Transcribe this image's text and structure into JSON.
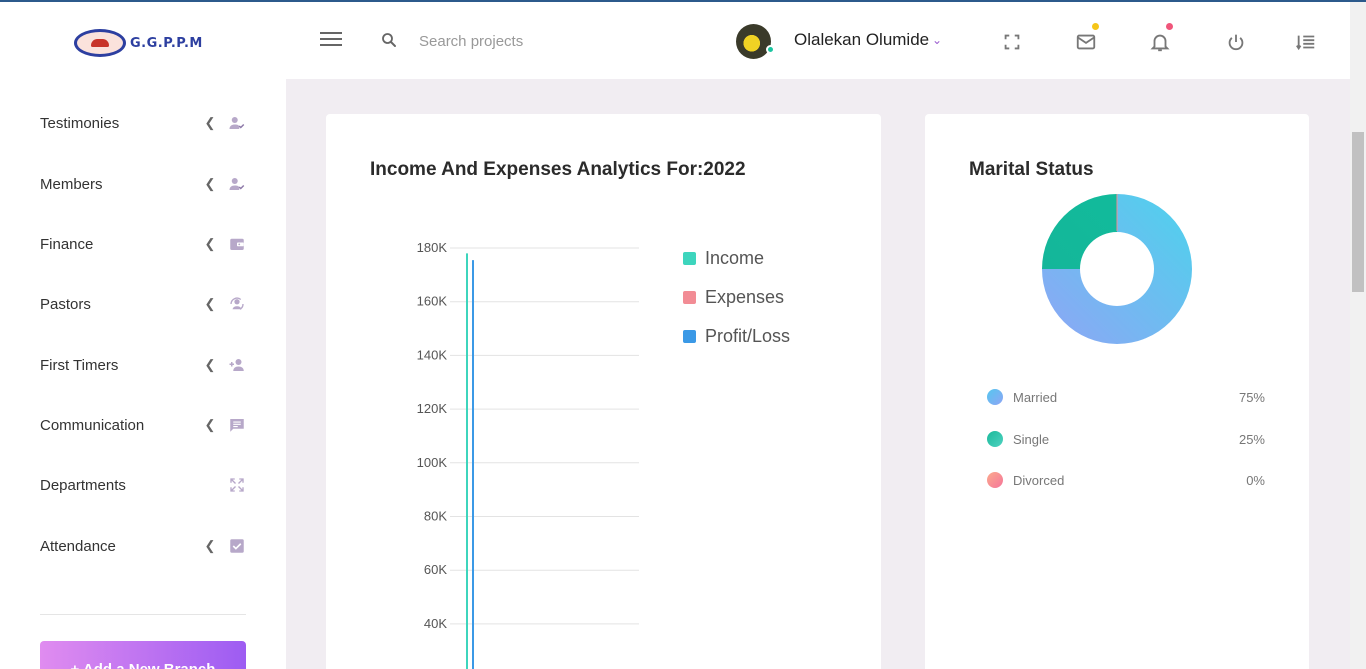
{
  "header": {
    "logo_text": "G.G.P.P.M",
    "search_placeholder": "Search projects",
    "user_name": "Olalekan Olumide"
  },
  "sidebar": {
    "items": [
      {
        "label": "Testimonies",
        "icon": "person-check-icon",
        "has_chevron": true
      },
      {
        "label": "Members",
        "icon": "person-check-icon",
        "has_chevron": true
      },
      {
        "label": "Finance",
        "icon": "wallet-icon",
        "has_chevron": true
      },
      {
        "label": "Pastors",
        "icon": "person-sync-icon",
        "has_chevron": true
      },
      {
        "label": "First Timers",
        "icon": "person-add-icon",
        "has_chevron": true
      },
      {
        "label": "Communication",
        "icon": "message-icon",
        "has_chevron": true
      },
      {
        "label": "Departments",
        "icon": "expand-icon",
        "has_chevron": false
      },
      {
        "label": "Attendance",
        "icon": "checkbox-icon",
        "has_chevron": true
      }
    ],
    "add_branch_label": "+ Add a New Branch"
  },
  "income_card": {
    "title": "Income And Expenses Analytics For:2022",
    "legend": [
      {
        "label": "Income",
        "color": "#3dd5bd"
      },
      {
        "label": "Expenses",
        "color": "#f28c95"
      },
      {
        "label": "Profit/Loss",
        "color": "#3b99e6"
      }
    ]
  },
  "chart_data": {
    "type": "bar",
    "title": "Income And Expenses Analytics For:2022",
    "xlabel": "",
    "ylabel": "",
    "ylim": [
      30000,
      190000
    ],
    "y_ticks": [
      "180K",
      "160K",
      "140K",
      "120K",
      "100K",
      "80K",
      "60K",
      "40K"
    ],
    "y_tick_values": [
      180000,
      160000,
      140000,
      120000,
      100000,
      80000,
      60000,
      40000
    ],
    "series": [
      {
        "name": "Income",
        "values": [
          178000
        ],
        "color": "#3dd5bd"
      },
      {
        "name": "Profit/Loss",
        "values": [
          175500
        ],
        "color": "#3b99e6"
      }
    ],
    "legend_position": "right",
    "grid": true
  },
  "marital_card": {
    "title": "Marital Status",
    "rows": [
      {
        "label": "Married",
        "value": "75%",
        "pct": 75,
        "colors": [
          "#8fa5f5",
          "#55c6ef"
        ]
      },
      {
        "label": "Single",
        "value": "25%",
        "pct": 25,
        "colors": [
          "#1bb99a",
          "#4fd2c1"
        ]
      },
      {
        "label": "Divorced",
        "value": "0%",
        "pct": 0,
        "colors": [
          "#fbaa8d",
          "#f5759a"
        ]
      }
    ]
  }
}
